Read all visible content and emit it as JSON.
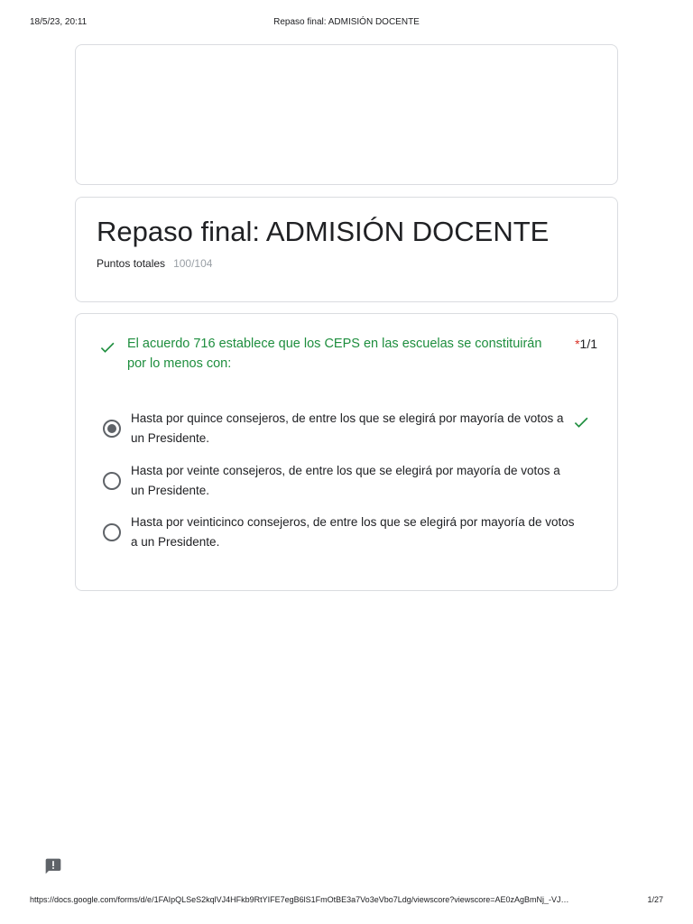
{
  "print_header": {
    "date": "18/5/23, 20:11",
    "title": "Repaso final: ADMISIÓN DOCENTE"
  },
  "form": {
    "title": "Repaso final: ADMISIÓN DOCENTE",
    "points_label": "Puntos totales",
    "points_value": "100/104"
  },
  "question": {
    "text": "El acuerdo 716 establece que los CEPS en las escuelas se constituirán por lo menos con:",
    "required_mark": "*",
    "score": "1/1",
    "status_icon": "check-icon",
    "correct_color": "#1e8e3e",
    "options": [
      {
        "label": "Hasta por quince consejeros, de entre los que se elegirá por mayoría de votos a un Presidente.",
        "selected": true,
        "correct": true
      },
      {
        "label": "Hasta por veinte consejeros, de entre los que se elegirá por mayoría de votos a un Presidente.",
        "selected": false,
        "correct": false
      },
      {
        "label": "Hasta por veinticinco consejeros, de entre los que se elegirá por mayoría de votos a un Presidente.",
        "selected": false,
        "correct": false
      }
    ]
  },
  "feedback": {
    "icon": "report-feedback-icon"
  },
  "print_footer": {
    "url": "https://docs.google.com/forms/d/e/1FAIpQLSeS2kqlVJ4HFkb9RtYIFE7egB6lS1FmOtBE3a7Vo3eVbo7Ldg/viewscore?viewscore=AE0zAgBmNj_-VJ…",
    "page": "1/27"
  }
}
